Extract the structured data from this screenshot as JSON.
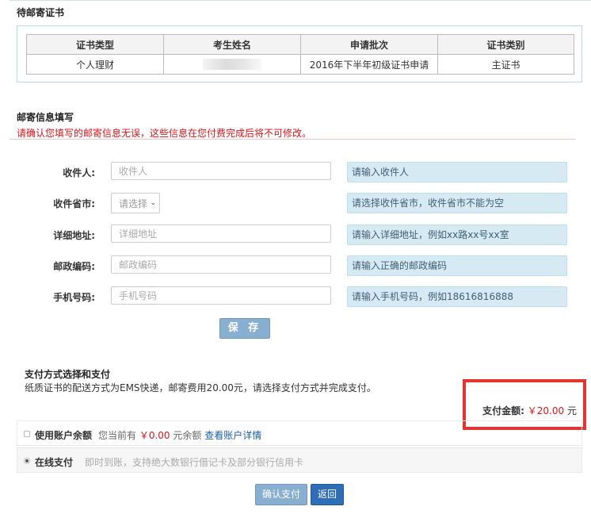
{
  "pending": {
    "title": "待邮寄证书",
    "headers": [
      "证书类型",
      "考生姓名",
      "申请批次",
      "证书类别"
    ],
    "row": {
      "type": "个人理财",
      "batch": "2016年下半年初级证书申请",
      "category": "主证书"
    }
  },
  "mail": {
    "title": "邮寄信息填写",
    "warning": "请确认您填写的邮寄信息无误，这些信息在您付费完成后将不可修改。",
    "fields": [
      {
        "label": "收件人:",
        "placeholder": "收件人",
        "hint": "请输入收件人"
      },
      {
        "label": "收件省市:",
        "select": "请选择",
        "hint": "请选择收件省市，收件省市不能为空"
      },
      {
        "label": "详细地址:",
        "placeholder": "详细地址",
        "hint": "请输入详细地址，例如xx路xx号xx室"
      },
      {
        "label": "邮政编码:",
        "placeholder": "邮政编码",
        "hint": "请输入正确的邮政编码"
      },
      {
        "label": "手机号码:",
        "placeholder": "手机号码",
        "hint": "请输入手机号码，例如18616816888"
      }
    ],
    "save": "保 存"
  },
  "payment": {
    "title": "支付方式选择和支付",
    "desc": "纸质证书的配送方式为EMS快递，邮寄费用20.00元，请选择支付方式并完成支付。",
    "amount_label": "支付金额:",
    "amount": "￥20.00",
    "amount_unit": "元",
    "balance": {
      "label": "使用账户余额",
      "prefix": "您当前有",
      "value": "￥0.00",
      "suffix": "元余额",
      "link": "查看账户详情"
    },
    "online": {
      "label": "在线支付",
      "desc": "即时到账，支持绝大数银行借记卡及部分银行信用卡"
    },
    "confirm": "确认支付",
    "back": "返回"
  },
  "colors": {
    "accent": "#d9161b",
    "hint_bg": "#d6eaf4",
    "highlight_border": "#e53333"
  }
}
